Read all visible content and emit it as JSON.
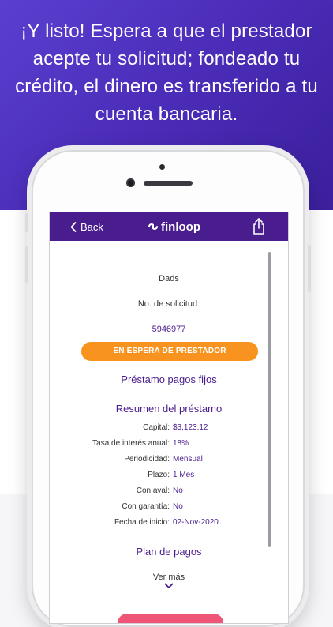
{
  "hero": {
    "text": "¡Y listo! Espera a que el prestador acepte tu solicitud; fondeado tu crédito, el dinero es transferido a tu cuenta bancaria."
  },
  "navbar": {
    "back_label": "Back",
    "logo_text": "finloop",
    "share_icon": "share-icon"
  },
  "loan": {
    "borrower_name": "Dads",
    "application_label": "No. de solicitud:",
    "application_number": "5946977",
    "status": "EN ESPERA DE PRESTADOR",
    "product_title": "Préstamo pagos fijos",
    "summary_title": "Resumen del préstamo",
    "details": [
      {
        "label": "Capital:",
        "value": "$3,123.12"
      },
      {
        "label": "Tasa de interés anual:",
        "value": "18%"
      },
      {
        "label": "Periodicidad:",
        "value": "Mensual"
      },
      {
        "label": "Plazo:",
        "value": "1 Mes"
      },
      {
        "label": "Con aval:",
        "value": "No"
      },
      {
        "label": "Con garantía:",
        "value": "No"
      },
      {
        "label": "Fecha de inicio:",
        "value": "02-Nov-2020"
      }
    ],
    "plan_title": "Plan de pagos",
    "see_more": "Ver más"
  },
  "colors": {
    "brand_purple": "#4a1d8e",
    "status_orange": "#f7931e",
    "hero_gradient_start": "#5a3fd0",
    "hero_gradient_end": "#3b1f9c",
    "action_pink": "#ee5577"
  }
}
